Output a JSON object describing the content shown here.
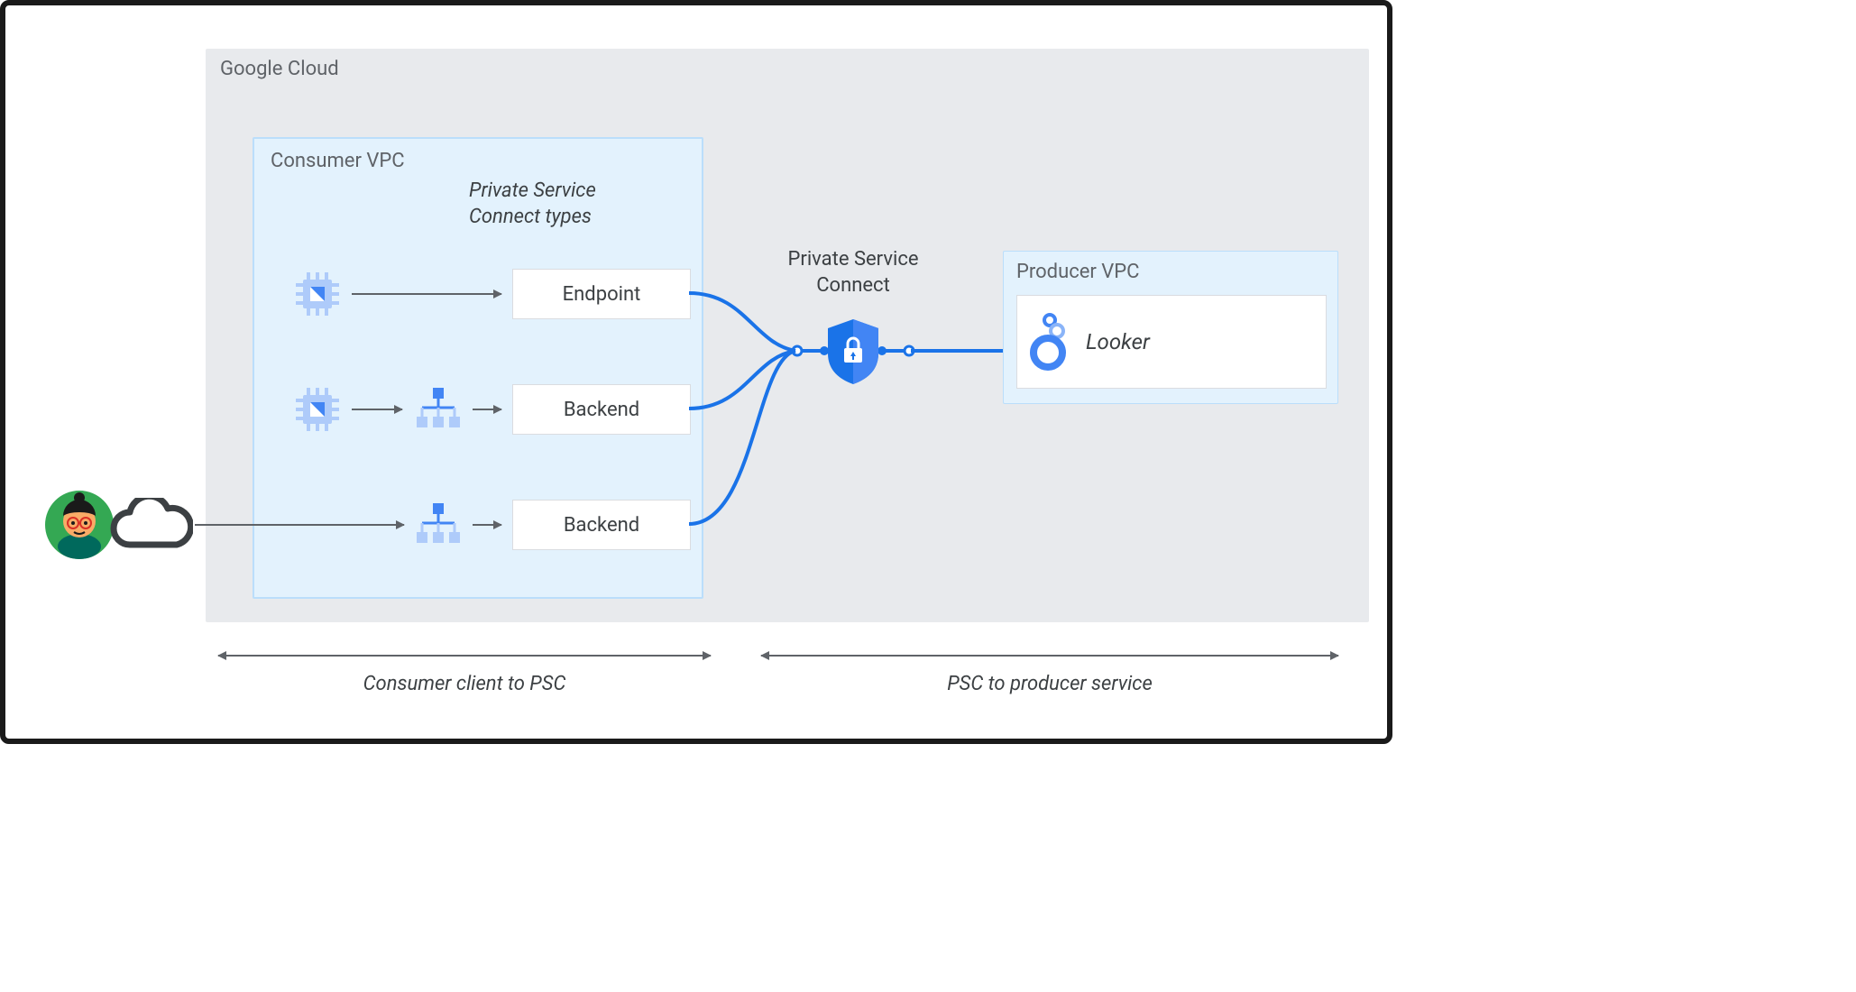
{
  "diagram": {
    "outer_label": "Google Cloud",
    "consumer_vpc_label": "Consumer VPC",
    "psc_types_heading": "Private Service\nConnect types",
    "type_boxes": {
      "endpoint": "Endpoint",
      "backend1": "Backend",
      "backend2": "Backend"
    },
    "psc_center_label": "Private Service\nConnect",
    "producer_vpc_label": "Producer VPC",
    "looker_label": "Looker",
    "bottom_left_caption": "Consumer client to PSC",
    "bottom_right_caption": "PSC to producer service"
  },
  "icons": {
    "compute": "compute-icon",
    "load_balancer": "load-balancer-icon",
    "user": "user-avatar-icon",
    "cloud": "cloud-icon",
    "shield": "psc-shield-icon",
    "looker": "looker-icon"
  },
  "colors": {
    "frame_border": "#1a1a1a",
    "gc_bg": "#e8eaed",
    "vpc_bg": "#e3f2fd",
    "vpc_border": "#bbdefb",
    "text_muted": "#5f6368",
    "text": "#3c4043",
    "blue_line": "#1a73e8",
    "icon_blue_light": "#8ab4f8",
    "icon_blue": "#4285f4",
    "avatar_green": "#34a853"
  }
}
